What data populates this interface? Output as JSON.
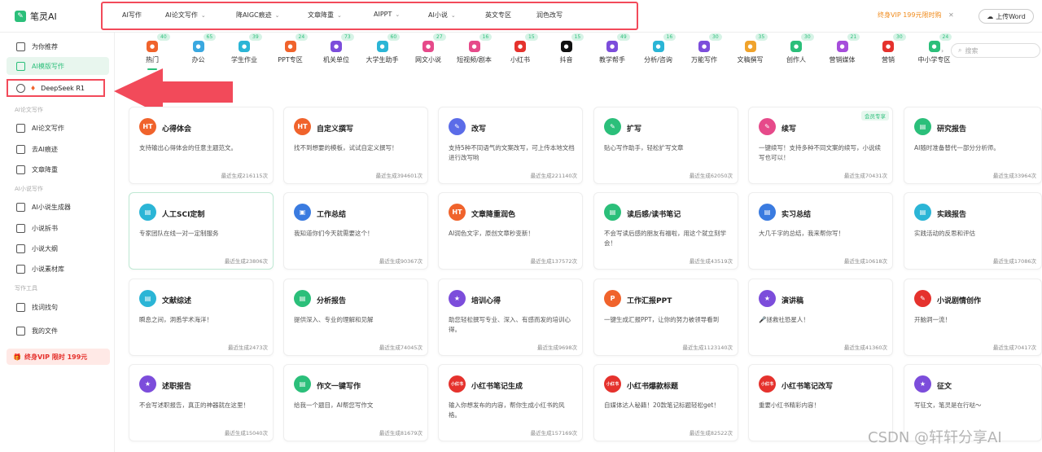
{
  "app": {
    "name": "笔灵AI"
  },
  "nav": {
    "items": [
      {
        "label": "AI写作",
        "dropdown": false
      },
      {
        "label": "AI论文写作",
        "dropdown": true
      },
      {
        "label": "降AIGC痕迹",
        "dropdown": true
      },
      {
        "label": "文章降重",
        "dropdown": true
      },
      {
        "label": "AIPPT",
        "dropdown": true
      },
      {
        "label": "AI小说",
        "dropdown": true
      },
      {
        "label": "英文专区",
        "dropdown": false
      },
      {
        "label": "润色改写",
        "dropdown": false
      }
    ]
  },
  "header": {
    "vip_text": "终身VIP 199元限时购",
    "upload_label": "上传Word"
  },
  "sidebar": {
    "items": [
      {
        "label": "为你推荐",
        "active": false
      },
      {
        "label": "AI模版写作",
        "active": true
      },
      {
        "label": "DeepSeek R1",
        "active": false
      }
    ],
    "sections": [
      {
        "title": "AI论文写作",
        "items": [
          "AI论文写作",
          "去AI痕迹",
          "文章降重"
        ]
      },
      {
        "title": "AI小说写作",
        "items": [
          "AI小说生成器",
          "小说拆书",
          "小说大纲",
          "小说素材库"
        ]
      },
      {
        "title": "写作工具",
        "items": [
          "找词找句"
        ]
      }
    ],
    "my_files": "我的文件",
    "vip_promo": "终身VIP 限时 199元"
  },
  "categories": [
    {
      "label": "热门",
      "count": "40",
      "color": "#f0632c",
      "icon": "fire-icon",
      "active": true
    },
    {
      "label": "办公",
      "count": "65",
      "color": "#3aa8e0",
      "icon": "briefcase-icon"
    },
    {
      "label": "学生作业",
      "count": "39",
      "color": "#2bb5d6",
      "icon": "book-icon"
    },
    {
      "label": "PPT专区",
      "count": "24",
      "color": "#f0632c",
      "icon": "ppt-icon"
    },
    {
      "label": "机关单位",
      "count": "73",
      "color": "#7c4ddb",
      "icon": "building-icon"
    },
    {
      "label": "大学生助手",
      "count": "60",
      "color": "#2bb5d6",
      "icon": "grad-icon"
    },
    {
      "label": "网文小说",
      "count": "27",
      "color": "#e64a8a",
      "icon": "novel-icon"
    },
    {
      "label": "短视频/剧本",
      "count": "16",
      "color": "#e64a8a",
      "icon": "video-icon"
    },
    {
      "label": "小红书",
      "count": "15",
      "color": "#e5322d",
      "icon": "redbook-icon"
    },
    {
      "label": "抖音",
      "count": "15",
      "color": "#111111",
      "icon": "tiktok-icon"
    },
    {
      "label": "教学帮手",
      "count": "49",
      "color": "#7c4ddb",
      "icon": "teach-icon"
    },
    {
      "label": "分析/咨询",
      "count": "16",
      "color": "#2bb5d6",
      "icon": "chart-icon"
    },
    {
      "label": "万能写作",
      "count": "30",
      "color": "#7c4ddb",
      "icon": "pen-icon"
    },
    {
      "label": "文稿撰写",
      "count": "35",
      "color": "#f0a32c",
      "icon": "doc-icon"
    },
    {
      "label": "创作人",
      "count": "30",
      "color": "#2bbf7a",
      "icon": "creator-icon"
    },
    {
      "label": "营销媒体",
      "count": "21",
      "color": "#a64ddb",
      "icon": "media-icon"
    },
    {
      "label": "营销",
      "count": "30",
      "color": "#e5322d",
      "icon": "marketing-icon"
    },
    {
      "label": "中小学专区",
      "count": "24",
      "color": "#2bbf7a",
      "icon": "school-icon"
    }
  ],
  "search": {
    "placeholder": "搜索"
  },
  "cards": [
    {
      "title": "心得体会",
      "desc": "支持输出心得体会的任意主题范文。",
      "count": "最近生成216115次",
      "icon": "HT",
      "color": "#f0632c"
    },
    {
      "title": "自定义撰写",
      "desc": "找不到想要的模板，试试自定义撰写！",
      "count": "最近生成394601次",
      "icon": "HT",
      "color": "#f0632c"
    },
    {
      "title": "改写",
      "desc": "支持5种不同语气的文案改写，可上传本地文档进行改写哟",
      "count": "最近生成221140次",
      "icon": "✎",
      "color": "#5b6ce8"
    },
    {
      "title": "扩写",
      "desc": "贴心写作助手，轻松扩写文章",
      "count": "最近生成62050次",
      "icon": "✎",
      "color": "#2bbf7a"
    },
    {
      "title": "续写",
      "desc": "一键续写！支持多种不同文案的续写，小说续写也可以！",
      "count": "最近生成70431次",
      "icon": "✎",
      "color": "#e64a8a",
      "badge": "会员专享"
    },
    {
      "title": "研究报告",
      "desc": "AI随时准备替代一部分分析师。",
      "count": "最近生成33964次",
      "icon": "▤",
      "color": "#2bbf7a"
    },
    {
      "title": "人工SCI定制",
      "desc": "专家团队在线一对一定制服务",
      "count": "最近生成23806次",
      "icon": "▤",
      "color": "#2bb5d6",
      "hl": true
    },
    {
      "title": "工作总结",
      "desc": "我知道你们今天就需要这个！",
      "count": "最近生成90367次",
      "icon": "▣",
      "color": "#3a7be0"
    },
    {
      "title": "文章降重润色",
      "desc": "AI润色文字，原创文章秒变新！",
      "count": "最近生成137572次",
      "icon": "HT",
      "color": "#f0632c"
    },
    {
      "title": "读后感/读书笔记",
      "desc": "不会写读后感的朋友有福啦，用这个就立刻学会！",
      "count": "最近生成43519次",
      "icon": "▤",
      "color": "#2bbf7a"
    },
    {
      "title": "实习总结",
      "desc": "大几千字的总结，我来帮你写！",
      "count": "最近生成10618次",
      "icon": "▤",
      "color": "#3a7be0"
    },
    {
      "title": "实践报告",
      "desc": "实践活动的反思和评估",
      "count": "最近生成17086次",
      "icon": "▤",
      "color": "#2bb5d6"
    },
    {
      "title": "文献综述",
      "desc": "瞬息之间，洞悉学术海洋！",
      "count": "最近生成2473次",
      "icon": "▤",
      "color": "#2bb5d6"
    },
    {
      "title": "分析报告",
      "desc": "提供深入、专业的理解和见解",
      "count": "最近生成74045次",
      "icon": "▤",
      "color": "#2bbf7a"
    },
    {
      "title": "培训心得",
      "desc": "助您轻松撰写专业、深入、有感而发的培训心得。",
      "count": "最近生成9698次",
      "icon": "★",
      "color": "#7c4ddb"
    },
    {
      "title": "工作汇报PPT",
      "desc": "一键生成汇报PPT，让你的努力被领导看到",
      "count": "最近生成1123140次",
      "icon": "P",
      "color": "#f0632c"
    },
    {
      "title": "演讲稿",
      "desc": "🎤拯救社恐星人！",
      "count": "最近生成41360次",
      "icon": "★",
      "color": "#7c4ddb"
    },
    {
      "title": "小说剧情创作",
      "desc": "开脑洞一流！",
      "count": "最近生成70417次",
      "icon": "✎",
      "color": "#e5322d"
    },
    {
      "title": "述职报告",
      "desc": "不会写述职报告，真正的神器就在这里！",
      "count": "最近生成15040次",
      "icon": "★",
      "color": "#7c4ddb"
    },
    {
      "title": "作文一键写作",
      "desc": "给我一个题目，AI帮您写作文",
      "count": "最近生成81679次",
      "icon": "▤",
      "color": "#2bbf7a"
    },
    {
      "title": "小红书笔记生成",
      "desc": "输入你想发布的内容，帮你生成小红书的风格。",
      "count": "最近生成157169次",
      "icon": "小红书",
      "color": "#e5322d"
    },
    {
      "title": "小红书爆款标题",
      "desc": "自媒体达人秘籍！20款笔记标题轻松get！",
      "count": "最近生成82522次",
      "icon": "小红书",
      "color": "#e5322d"
    },
    {
      "title": "小红书笔记改写",
      "desc": "重要小红书精彩内容！",
      "count": "",
      "icon": "小红书",
      "color": "#e5322d"
    },
    {
      "title": "征文",
      "desc": "写征文，笔灵是在行哒～",
      "count": "",
      "icon": "★",
      "color": "#7c4ddb"
    }
  ],
  "watermark": "CSDN @轩轩分享AI"
}
